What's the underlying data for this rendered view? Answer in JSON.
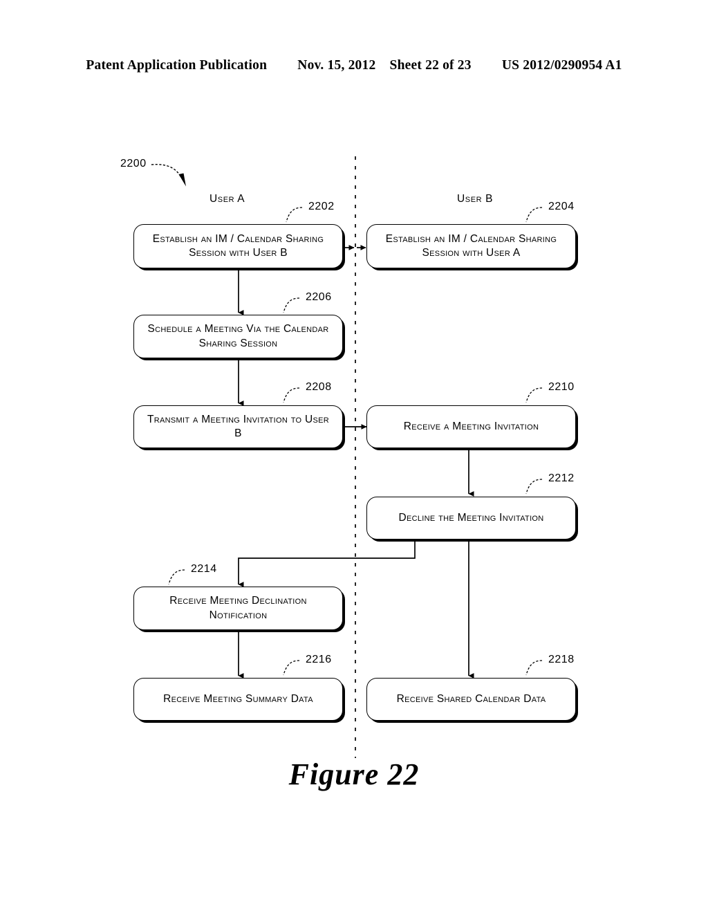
{
  "header": {
    "publication": "Patent Application Publication",
    "date": "Nov. 15, 2012",
    "sheet": "Sheet 22 of 23",
    "patent_number": "US 2012/0290954 A1"
  },
  "figure": {
    "caption": "Figure 22",
    "diagram_ref": "2200",
    "lanes": [
      {
        "id": "lane-user-a",
        "title": "User A"
      },
      {
        "id": "lane-user-b",
        "title": "User B"
      }
    ],
    "nodes": [
      {
        "ref": "2202",
        "lane": "A",
        "name": "establish-session-user-b",
        "label": "Establish an IM / Calendar Sharing Session with User B"
      },
      {
        "ref": "2204",
        "lane": "B",
        "name": "establish-session-user-a",
        "label": "Establish an IM / Calendar Sharing Session with User A"
      },
      {
        "ref": "2206",
        "lane": "A",
        "name": "schedule-meeting",
        "label": "Schedule a Meeting Via the Calendar Sharing Session"
      },
      {
        "ref": "2208",
        "lane": "A",
        "name": "transmit-meeting-invitation",
        "label": "Transmit a Meeting Invitation to User B"
      },
      {
        "ref": "2210",
        "lane": "B",
        "name": "receive-meeting-invitation",
        "label": "Receive a Meeting Invitation"
      },
      {
        "ref": "2212",
        "lane": "B",
        "name": "decline-meeting-invitation",
        "label": "Decline the Meeting Invitation"
      },
      {
        "ref": "2214",
        "lane": "A",
        "name": "receive-declination-notification",
        "label": "Receive Meeting Declination Notification"
      },
      {
        "ref": "2216",
        "lane": "A",
        "name": "receive-meeting-summary-data",
        "label": "Receive Meeting Summary Data"
      },
      {
        "ref": "2218",
        "lane": "B",
        "name": "receive-shared-calendar-data",
        "label": "Receive Shared Calendar Data"
      }
    ]
  }
}
